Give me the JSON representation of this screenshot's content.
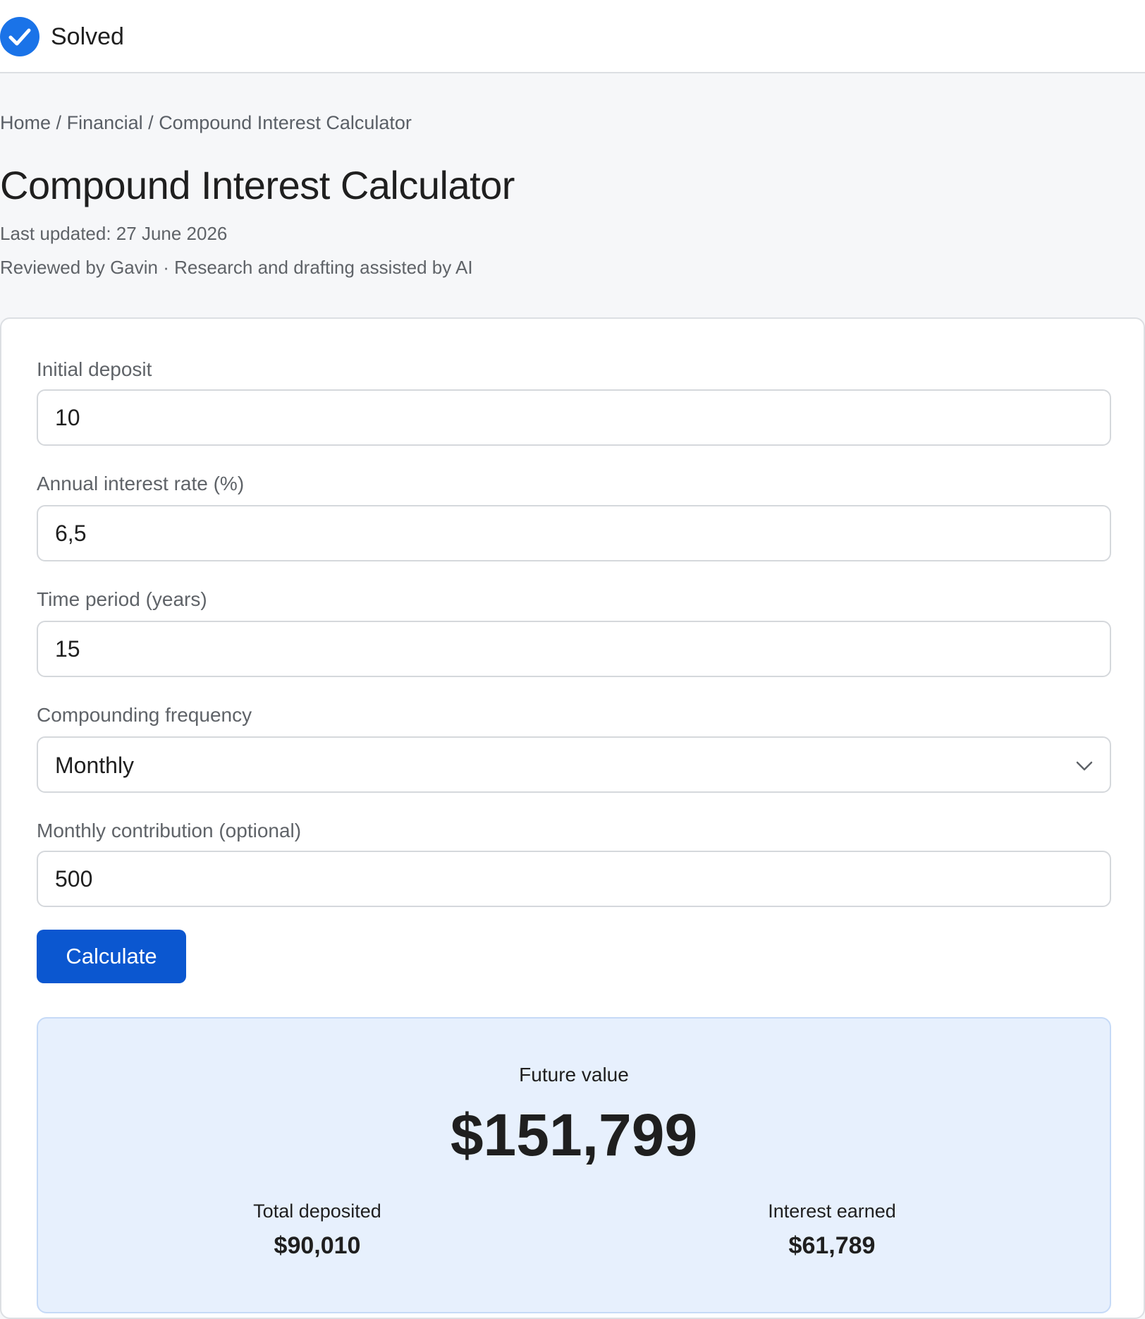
{
  "status": {
    "label": "Solved",
    "icon": "check-circle-icon",
    "color": "#1a73e8"
  },
  "breadcrumb": {
    "items": [
      "Home",
      "Financial",
      "Compound Interest Calculator"
    ],
    "separator": "/"
  },
  "page": {
    "title": "Compound Interest Calculator",
    "last_updated": "Last updated: 27 June 2026",
    "reviewed": "Reviewed by Gavin · Research and drafting assisted by AI"
  },
  "form": {
    "initial_deposit": {
      "label": "Initial deposit",
      "value": "10"
    },
    "interest_rate": {
      "label": "Annual interest rate (%)",
      "value": "6,5"
    },
    "time_period": {
      "label": "Time period (years)",
      "value": "15"
    },
    "compounding": {
      "label": "Compounding frequency",
      "selected": "Monthly",
      "icon": "chevron-down-icon"
    },
    "monthly_contribution": {
      "label": "Monthly contribution (optional)",
      "value": "500"
    },
    "calculate_label": "Calculate",
    "button_color": "#0b57d0"
  },
  "results": {
    "future_value_label": "Future value",
    "future_value": "$151,799",
    "total_deposited_label": "Total deposited",
    "total_deposited": "$90,010",
    "interest_earned_label": "Interest earned",
    "interest_earned": "$61,789",
    "panel_color": "#e7f0fd"
  }
}
